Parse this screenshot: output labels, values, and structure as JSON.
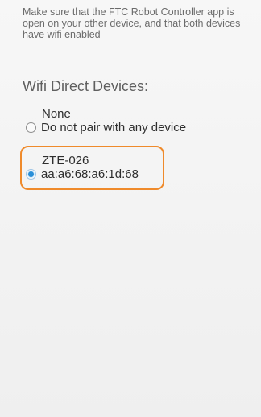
{
  "instruction_text": "Make sure that the FTC Robot Controller app is open on your other device, and that both devices have wifi enabled",
  "section_title": "Wifi Direct Devices:",
  "devices": [
    {
      "name": "None",
      "detail": "Do not pair with any device",
      "selected": false
    },
    {
      "name": "ZTE-026",
      "detail": "aa:a6:68:a6:1d:68",
      "selected": true
    }
  ],
  "colors": {
    "highlight": "#ef8a2b",
    "radio_selected": "#2a8fd8",
    "background": "#f4f4f4"
  },
  "icons": {
    "radio_unselected": "radio-unchecked-icon",
    "radio_selected": "radio-checked-icon"
  }
}
